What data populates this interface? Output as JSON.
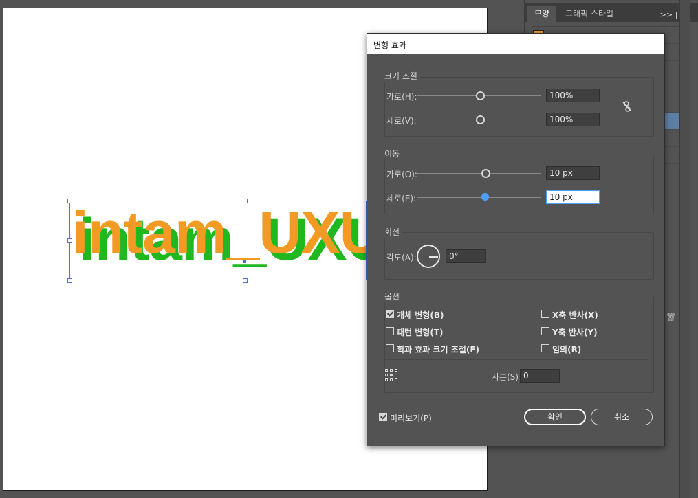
{
  "canvas": {
    "text": "intam_UXU",
    "colors": {
      "fill": "#f39a25",
      "shadow": "#1fb81f",
      "selection": "#4a72d6"
    }
  },
  "panel": {
    "tabs": [
      {
        "label": "모양"
      },
      {
        "label": "그래픽 스타일"
      }
    ],
    "menu_label": ">> | ≡"
  },
  "dialog": {
    "title": "변형 효과",
    "scale": {
      "title": "크기 조절",
      "horizontal": {
        "label": "가로(H):",
        "value": "100%",
        "slider_fraction": 0.5
      },
      "vertical": {
        "label": "세로(V):",
        "value": "100%",
        "slider_fraction": 0.5
      }
    },
    "move": {
      "title": "이동",
      "horizontal": {
        "label": "가로(O):",
        "value": "10 px",
        "slider_fraction": 0.55
      },
      "vertical": {
        "label": "세로(E):",
        "value": "10 px",
        "slider_fraction": 0.55
      }
    },
    "rotate": {
      "title": "회전",
      "angle_label": "각도(A):",
      "angle_value": "0°"
    },
    "options": {
      "title": "옵션",
      "items": [
        {
          "label": "개체 변형(B)",
          "checked": true
        },
        {
          "label": "패턴 변형(T)",
          "checked": false
        },
        {
          "label": "획과 효과 크기 조절(F)",
          "checked": false
        },
        {
          "label": "X축 반사(X)",
          "checked": false
        },
        {
          "label": "Y축 반사(Y)",
          "checked": false
        },
        {
          "label": "임의(R)",
          "checked": false
        }
      ],
      "copies_label": "사본(S)",
      "copies_value": "0"
    },
    "preview": {
      "label": "미리보기(P)",
      "checked": true
    },
    "ok_label": "확인",
    "cancel_label": "취소"
  }
}
